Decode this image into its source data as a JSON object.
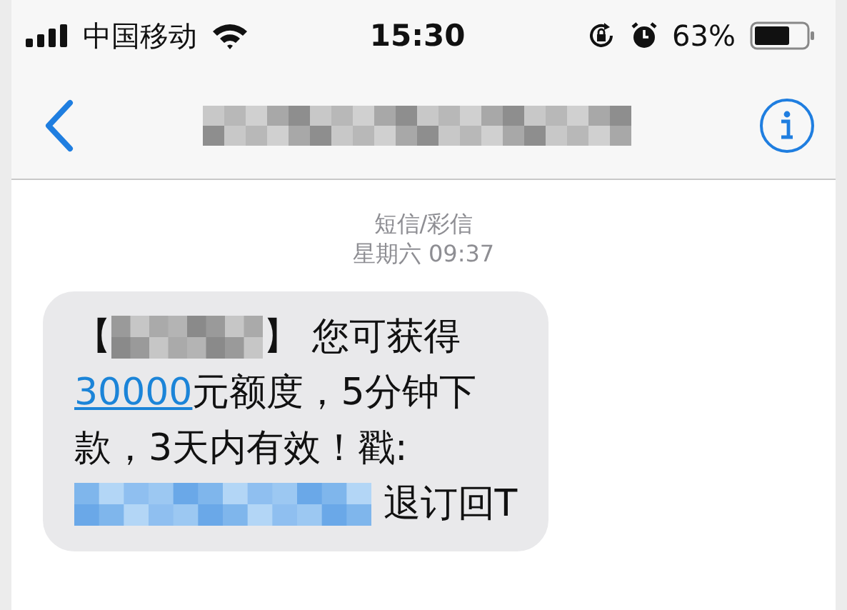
{
  "status_bar": {
    "carrier": "中国移动",
    "time": "15:30",
    "battery_text": "63%"
  },
  "nav": {
    "title": {
      "kind": "redacted"
    }
  },
  "thread": {
    "service": "短信/彩信",
    "timestamp": "星期六 09:37"
  },
  "message": {
    "lines": [
      [
        {
          "kind": "text",
          "text": "【"
        },
        {
          "kind": "redacted"
        },
        {
          "kind": "text",
          "text": "】 您可获得"
        }
      ],
      [
        {
          "kind": "link",
          "text": "30000"
        },
        {
          "kind": "text",
          "text": "元额度，5分钟下"
        }
      ],
      [
        {
          "kind": "text",
          "text": "款，3天内有效！戳:"
        }
      ],
      [
        {
          "kind": "redacted_link"
        },
        {
          "kind": "text",
          "text": " 退订回T"
        }
      ]
    ]
  }
}
